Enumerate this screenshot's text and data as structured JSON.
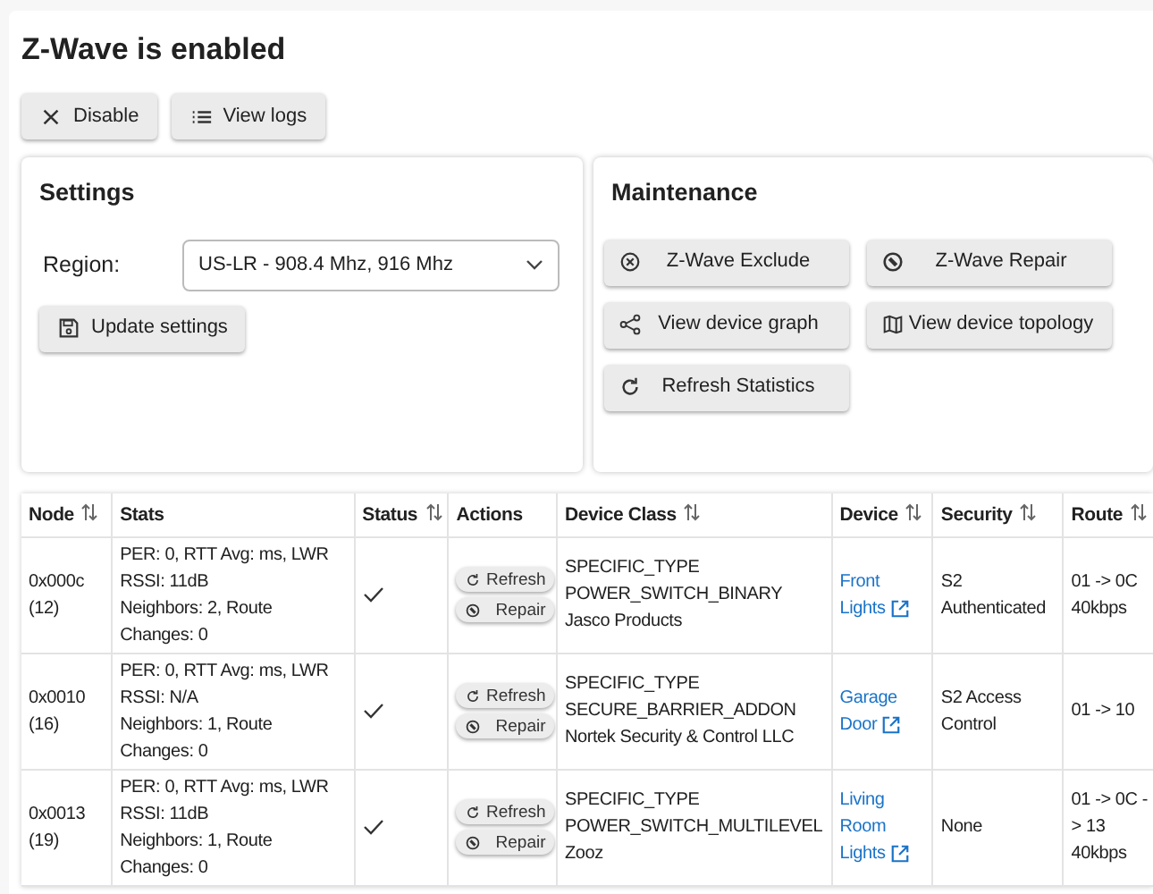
{
  "title": "Z-Wave is enabled",
  "top_buttons": [
    {
      "label": "Disable"
    },
    {
      "label": "View logs"
    }
  ],
  "settings": {
    "title": "Settings",
    "region_label": "Region:",
    "region_value": "US-LR - 908.4 Mhz, 916 Mhz",
    "button": {
      "label": "Update settings"
    }
  },
  "maintenance": {
    "title": "Maintenance",
    "buttons": [
      {
        "label": "Z-Wave Exclude"
      },
      {
        "label": "Z-Wave Repair"
      },
      {
        "label": "View device graph"
      },
      {
        "label": "View device topology"
      },
      {
        "label": "Refresh Statistics"
      }
    ]
  },
  "table": {
    "columns": [
      {
        "label": "Node",
        "sortable": true
      },
      {
        "label": "Stats",
        "sortable": false
      },
      {
        "label": "Status",
        "sortable": true
      },
      {
        "label": "Actions",
        "sortable": false
      },
      {
        "label": "Device Class",
        "sortable": true
      },
      {
        "label": "Device",
        "sortable": true
      },
      {
        "label": "Security",
        "sortable": true
      },
      {
        "label": "Route",
        "sortable": true
      }
    ],
    "rows": [
      {
        "node": "0x000c (12)",
        "stats": [
          "PER: 0, RTT Avg: ms, LWR",
          "RSSI: 11dB",
          "Neighbors: 2, Route",
          "Changes: 0"
        ],
        "status_ok": true,
        "actions": [
          "Refresh",
          "Repair"
        ],
        "device_class": [
          "SPECIFIC_TYPE",
          "POWER_SWITCH_BINARY",
          "Jasco Products"
        ],
        "device": "Front Lights",
        "security": "S2 Authenticated",
        "route": "01 -> 0C 40kbps"
      },
      {
        "node": "0x0010 (16)",
        "stats": [
          "PER: 0, RTT Avg: ms, LWR",
          "RSSI: N/A",
          "Neighbors: 1, Route",
          "Changes: 0"
        ],
        "status_ok": true,
        "actions": [
          "Refresh",
          "Repair"
        ],
        "device_class": [
          "SPECIFIC_TYPE",
          "SECURE_BARRIER_ADDON",
          "Nortek Security & Control LLC"
        ],
        "device": "Garage Door",
        "security": "S2 Access Control",
        "route": "01 -> 10"
      },
      {
        "node": "0x0013 (19)",
        "stats": [
          "PER: 0, RTT Avg: ms, LWR",
          "RSSI: 11dB",
          "Neighbors: 1, Route",
          "Changes: 0"
        ],
        "status_ok": true,
        "actions": [
          "Refresh",
          "Repair"
        ],
        "device_class": [
          "SPECIFIC_TYPE",
          "POWER_SWITCH_MULTILEVEL",
          "Zooz"
        ],
        "device": "Living Room Lights",
        "security": "None",
        "route": "01 -> 0C -> 13 40kbps"
      }
    ]
  }
}
